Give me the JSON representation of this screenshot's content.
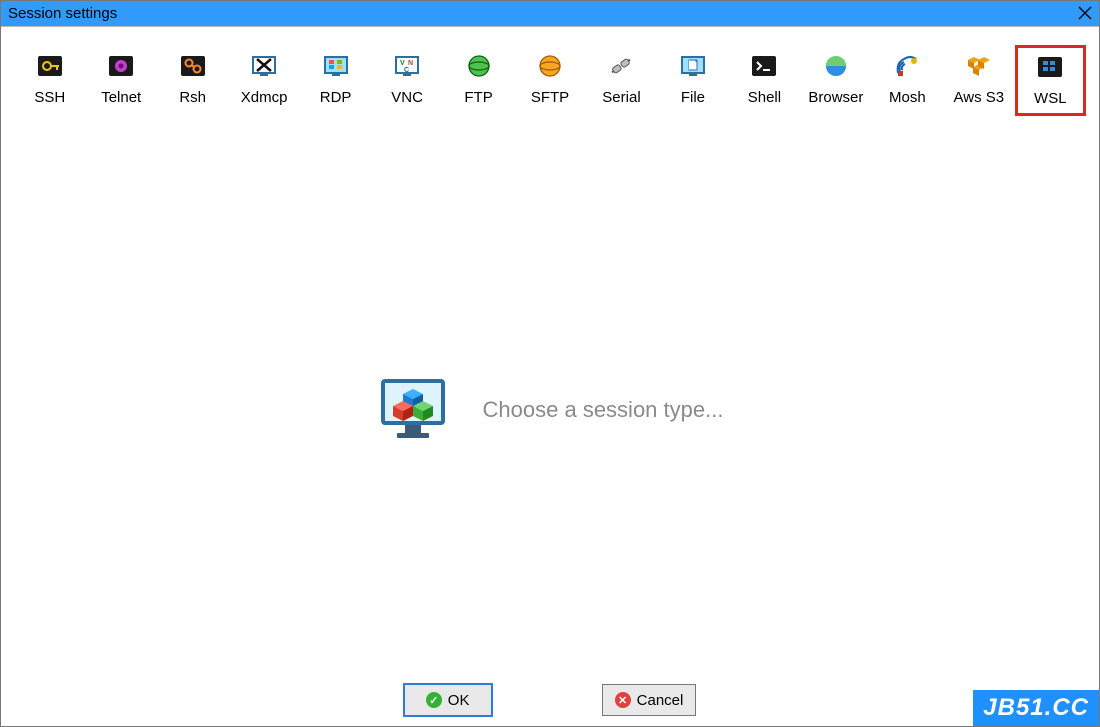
{
  "window": {
    "title": "Session settings"
  },
  "sessions": [
    {
      "id": "ssh",
      "label": "SSH",
      "icon": "key-icon"
    },
    {
      "id": "telnet",
      "label": "Telnet",
      "icon": "telnet-icon"
    },
    {
      "id": "rsh",
      "label": "Rsh",
      "icon": "rsh-icon"
    },
    {
      "id": "xdmcp",
      "label": "Xdmcp",
      "icon": "xdmcp-icon"
    },
    {
      "id": "rdp",
      "label": "RDP",
      "icon": "rdp-icon"
    },
    {
      "id": "vnc",
      "label": "VNC",
      "icon": "vnc-icon"
    },
    {
      "id": "ftp",
      "label": "FTP",
      "icon": "ftp-icon"
    },
    {
      "id": "sftp",
      "label": "SFTP",
      "icon": "sftp-icon"
    },
    {
      "id": "serial",
      "label": "Serial",
      "icon": "serial-icon"
    },
    {
      "id": "file",
      "label": "File",
      "icon": "file-icon"
    },
    {
      "id": "shell",
      "label": "Shell",
      "icon": "shell-icon"
    },
    {
      "id": "browser",
      "label": "Browser",
      "icon": "browser-icon"
    },
    {
      "id": "mosh",
      "label": "Mosh",
      "icon": "mosh-icon"
    },
    {
      "id": "awss3",
      "label": "Aws S3",
      "icon": "aws-s3-icon"
    },
    {
      "id": "wsl",
      "label": "WSL",
      "icon": "wsl-icon",
      "highlight": true
    }
  ],
  "prompt": {
    "text": "Choose a session type..."
  },
  "buttons": {
    "ok": "OK",
    "cancel": "Cancel"
  },
  "watermark": "JB51.CC"
}
